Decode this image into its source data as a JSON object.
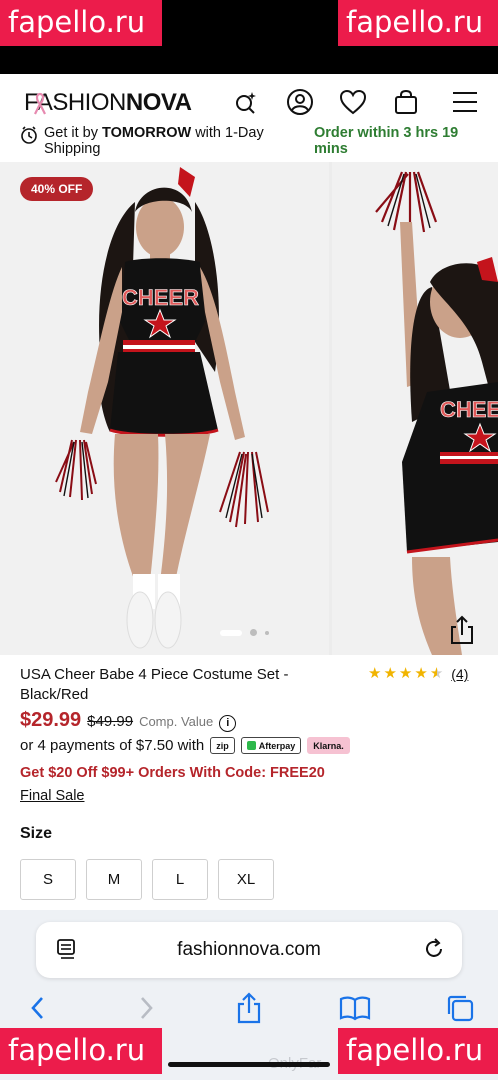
{
  "watermarks": {
    "top_left": "fapello.ru",
    "top_right": "fapello.ru",
    "bottom_left": "fapello.ru",
    "bottom_right": "fapello.ru",
    "bottom_center": "OnlyFar"
  },
  "header": {
    "logo_fashion": "FASHION",
    "logo_nova": "NOVA",
    "icons": [
      "ribbon-icon",
      "ai-search-icon",
      "account-icon",
      "wishlist-heart-icon",
      "shopping-bag-icon",
      "hamburger-menu-icon"
    ]
  },
  "delivery": {
    "prefix": "Get it by ",
    "day": "TOMORROW",
    "suffix": " with 1-Day Shipping",
    "countdown": "Order within 3 hrs 19 mins"
  },
  "gallery": {
    "badge": "40% OFF",
    "image_main_alt": "Model in black and red cheer costume holding pom poms",
    "image_side_alt": "Model raising pom pom in cheer costume",
    "current_slide": 1,
    "total_slides": 3
  },
  "product": {
    "title": "USA Cheer Babe 4 Piece Costume Set - Black/Red",
    "rating": 4.5,
    "review_count": "(4)",
    "price": "$29.99",
    "original_price": "$49.99",
    "comp_value_label": "Comp. Value",
    "installments_text": "or 4 payments of $7.50 with",
    "payment_providers": [
      "zip",
      "Afterpay",
      "Klarna."
    ],
    "promo": "Get $20 Off $99+ Orders With Code: FREE20",
    "final_sale": "Final Sale",
    "size_label": "Size",
    "sizes": [
      "S",
      "M",
      "L",
      "XL"
    ]
  },
  "browser": {
    "url": "fashionnova.com",
    "toolbar": [
      "back-icon",
      "forward-icon",
      "share-icon",
      "bookmarks-icon",
      "tabs-icon"
    ]
  },
  "colors": {
    "accent_red": "#b5252b",
    "delivery_green": "#2e7d32",
    "rating_star": "#f1b400",
    "watermark": "#ec1c4b"
  }
}
